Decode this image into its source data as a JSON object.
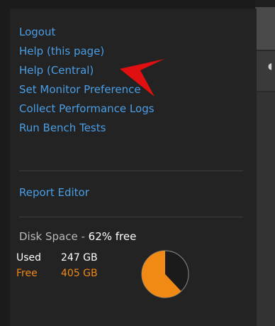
{
  "menu": {
    "items": [
      {
        "label": "Logout"
      },
      {
        "label": "Help (this page)"
      },
      {
        "label": "Help (Central)"
      },
      {
        "label": "Set Monitor Preference"
      },
      {
        "label": "Collect Performance Logs"
      },
      {
        "label": "Run Bench Tests"
      }
    ],
    "report_editor": "Report Editor"
  },
  "disk": {
    "title_prefix": "Disk Space - ",
    "percent_free": "62% free",
    "used_label": "Used",
    "used_value": "247 GB",
    "free_label": "Free",
    "free_value": "405 GB",
    "free_fraction": 0.62,
    "colors": {
      "free": "#f08a15",
      "used": "#1b1b1b",
      "link": "#4a9ee6"
    }
  },
  "annotation": {
    "pointer_icon": "red-arrow-icon",
    "color": "#e01010"
  }
}
